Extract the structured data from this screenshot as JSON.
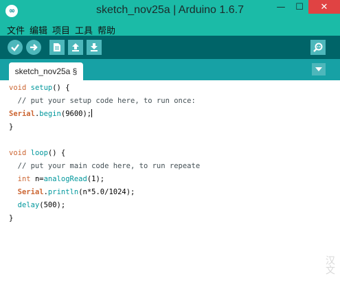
{
  "window": {
    "title": "sketch_nov25a | Arduino 1.6.7",
    "logo_text": "∞",
    "minimize_glyph": "—",
    "maximize_glyph": "☐",
    "close_glyph": "✕"
  },
  "menu": [
    "文件",
    "编辑",
    "项目",
    "工具",
    "帮助"
  ],
  "toolbar": {
    "buttons": [
      "verify-icon",
      "upload-icon",
      "new-icon",
      "open-icon",
      "save-icon"
    ],
    "serial_monitor": "serial-monitor-icon"
  },
  "tabs": {
    "active_label": "sketch_nov25a §",
    "menu": "chevron-down-icon"
  },
  "colors": {
    "titlebar": "#1bbba7",
    "toolbar": "#006468",
    "tabstrip": "#17a1a5",
    "button": "#4db7bb",
    "keyword_type": "#cc6633",
    "keyword_function": "#00979c",
    "comment": "#434f54"
  },
  "code": [
    [
      {
        "t": "void",
        "c": "kw"
      },
      {
        "t": " "
      },
      {
        "t": "setup",
        "c": "fn"
      },
      {
        "t": "() {"
      }
    ],
    [
      {
        "t": "  // put your setup code here, to run once:",
        "c": "cm"
      }
    ],
    [
      {
        "t": "Serial",
        "c": "obj"
      },
      {
        "t": "."
      },
      {
        "t": "begin",
        "c": "fn"
      },
      {
        "t": "(9600);"
      }
    ],
    [
      {
        "t": "}"
      }
    ],
    [
      {
        "t": ""
      }
    ],
    [
      {
        "t": "void",
        "c": "kw"
      },
      {
        "t": " "
      },
      {
        "t": "loop",
        "c": "fn"
      },
      {
        "t": "() {"
      }
    ],
    [
      {
        "t": "  // put your main code here, to run repeate",
        "c": "cm"
      }
    ],
    [
      {
        "t": "  "
      },
      {
        "t": "int",
        "c": "kw"
      },
      {
        "t": " n="
      },
      {
        "t": "analogRead",
        "c": "fn"
      },
      {
        "t": "(1);"
      }
    ],
    [
      {
        "t": "  "
      },
      {
        "t": "Serial",
        "c": "obj"
      },
      {
        "t": "."
      },
      {
        "t": "println",
        "c": "fn"
      },
      {
        "t": "(n*5.0/1024);"
      }
    ],
    [
      {
        "t": "  "
      },
      {
        "t": "delay",
        "c": "fn"
      },
      {
        "t": "(500);"
      }
    ],
    [
      {
        "t": "}"
      }
    ]
  ],
  "watermark": "汉文"
}
